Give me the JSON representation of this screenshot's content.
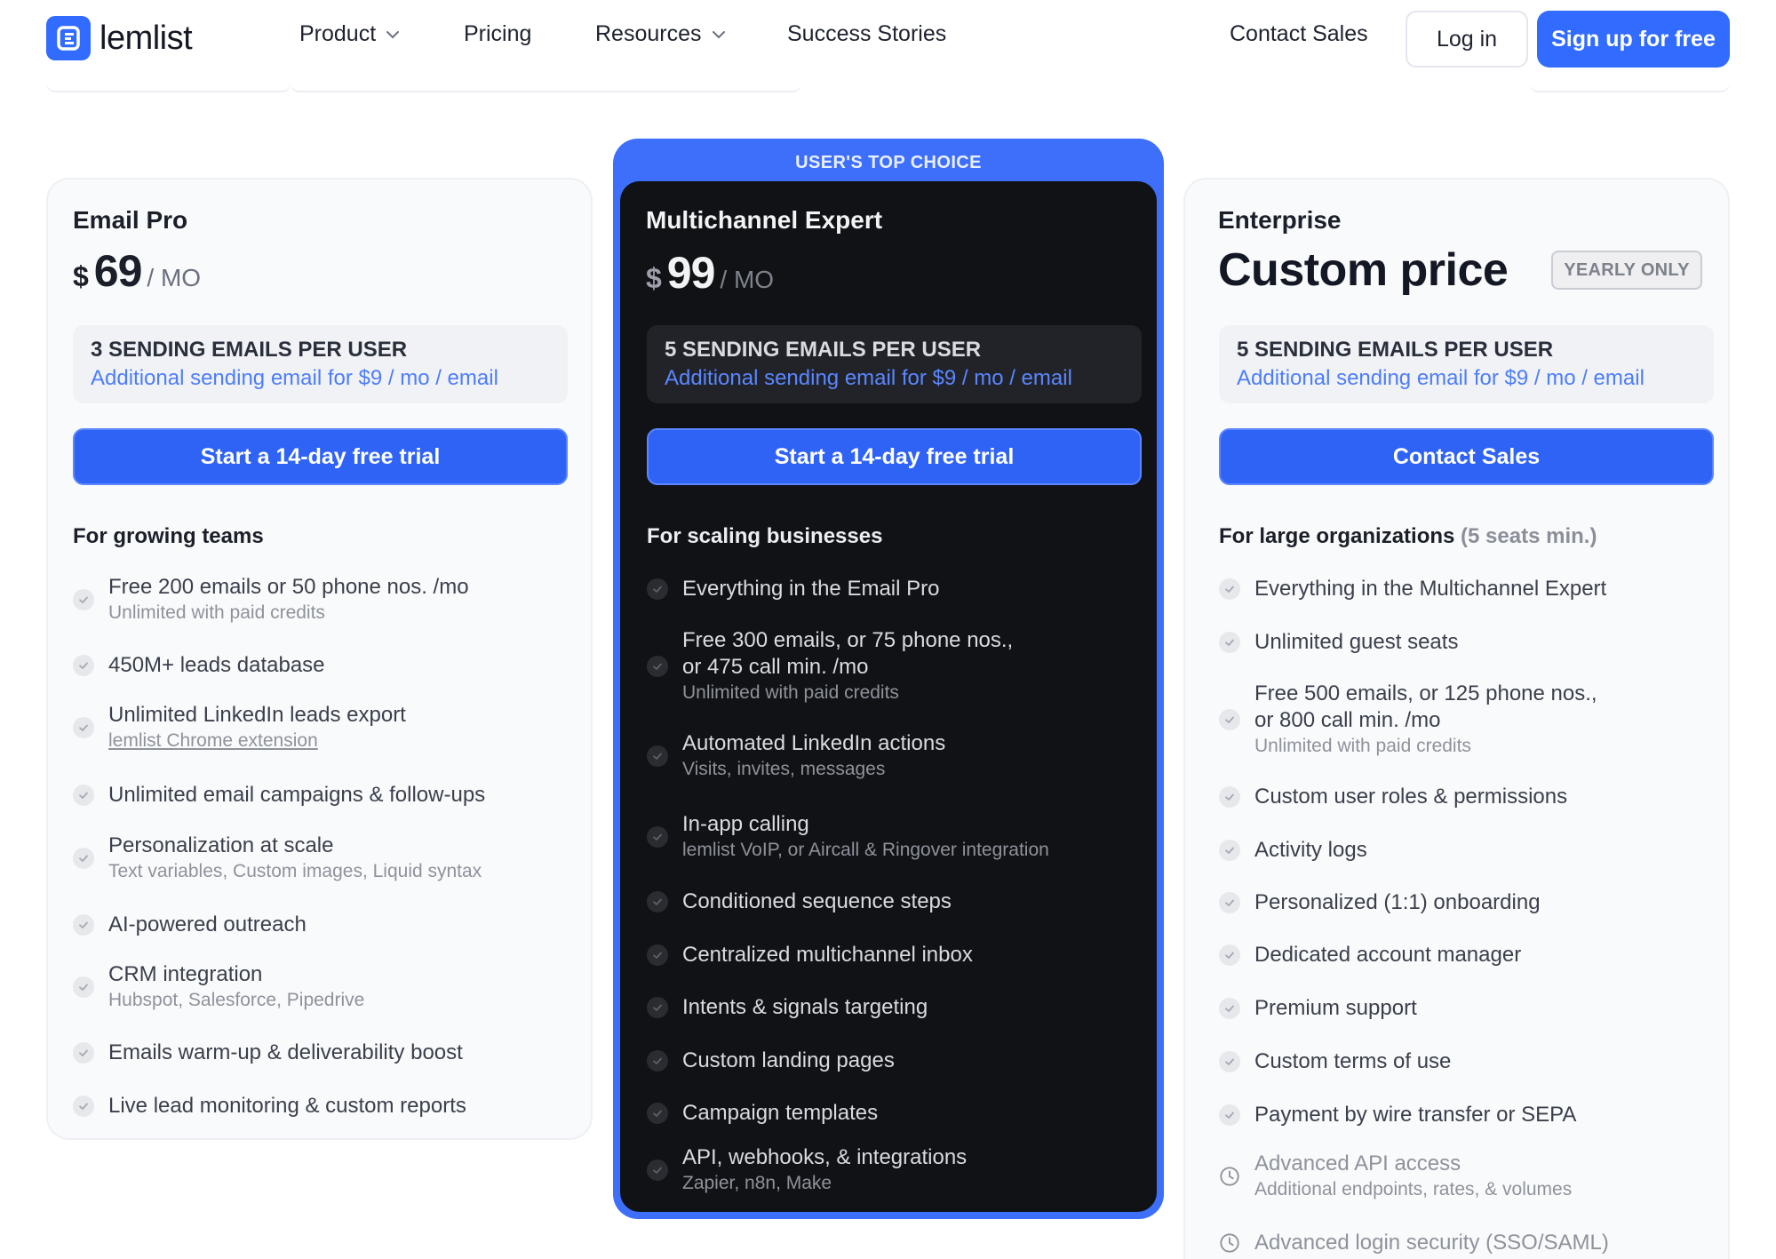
{
  "nav": {
    "logo_text": "lemlist",
    "items": [
      {
        "label": "Product",
        "dropdown": true
      },
      {
        "label": "Pricing",
        "dropdown": false
      },
      {
        "label": "Resources",
        "dropdown": true
      },
      {
        "label": "Success Stories",
        "dropdown": false
      }
    ],
    "contact_sales": "Contact Sales",
    "login": "Log in",
    "signup": "Sign up for free"
  },
  "colors": {
    "accent": "#316bff",
    "dark_card": "#111215",
    "highlight_border": "#3d6ffb",
    "link_blue": "#4c7dfb"
  },
  "plans": [
    {
      "name": "Email Pro",
      "currency": "$",
      "price": "69",
      "period": "/ MO",
      "sending_title": "3 sending emails per user",
      "sending_extra": "Additional sending email for $9  / mo / email",
      "cta": "Start a 14-day free trial",
      "for": "For growing teams",
      "features": [
        {
          "main": "Free 200 emails or 50 phone nos. /mo",
          "sub": "Unlimited with paid credits"
        },
        {
          "main": "450M+ leads database",
          "sub": ""
        },
        {
          "main": "Unlimited LinkedIn leads export",
          "sub": "lemlist Chrome extension"
        },
        {
          "main": "Unlimited email campaigns & follow-ups",
          "sub": ""
        },
        {
          "main": "Personalization at scale",
          "sub": "Text variables, Custom images, Liquid syntax"
        },
        {
          "main": "AI-powered outreach",
          "sub": ""
        },
        {
          "main": "CRM integration",
          "sub": "Hubspot, Salesforce, Pipedrive"
        },
        {
          "main": "Emails warm-up & deliverability boost",
          "sub": ""
        },
        {
          "main": "Live lead monitoring & custom reports",
          "sub": ""
        }
      ]
    },
    {
      "badge": "USER'S TOP CHOICE",
      "name": "Multichannel Expert",
      "currency": "$",
      "price": "99",
      "period": "/ MO",
      "sending_title": "5 sending emails per user",
      "sending_extra": "Additional sending email for $9  / mo / email",
      "cta": "Start a 14-day free trial",
      "for": "For scaling businesses",
      "features": [
        {
          "main": "Everything in the Email Pro",
          "sub": ""
        },
        {
          "main": "Free 300 emails, or 75 phone nos., or 475 call min. /mo",
          "main_line1": "Free 300 emails, or 75 phone nos.,",
          "main_line2": "or 475 call min. /mo",
          "sub": "Unlimited with paid credits"
        },
        {
          "main": "Automated LinkedIn actions",
          "sub": "Visits, invites, messages"
        },
        {
          "main": "In-app calling",
          "sub": "lemlist VoIP, or Aircall & Ringover integration"
        },
        {
          "main": "Conditioned sequence steps",
          "sub": ""
        },
        {
          "main": "Centralized multichannel inbox",
          "sub": ""
        },
        {
          "main": "Intents & signals targeting",
          "sub": ""
        },
        {
          "main": "Custom landing pages",
          "sub": ""
        },
        {
          "main": "Campaign templates",
          "sub": ""
        },
        {
          "main": "API, webhooks, & integrations",
          "sub": "Zapier, n8n, Make"
        }
      ]
    },
    {
      "name": "Enterprise",
      "price_text": "Custom price",
      "billing_badge": "YEARLY ONLY",
      "sending_title": "5 sending emails per user",
      "sending_extra": "Additional sending email for $9  / mo / email",
      "cta": "Contact Sales",
      "for": "For large organizations",
      "for_note": "(5 seats min.)",
      "features": [
        {
          "main": "Everything in the Multichannel Expert",
          "sub": "",
          "icon": "check-icon"
        },
        {
          "main": "Unlimited guest seats",
          "sub": "",
          "icon": "check-icon"
        },
        {
          "main_line1": "Free 500 emails, or 125 phone nos.,",
          "main_line2": "or 800 call min. /mo",
          "sub": "Unlimited with paid credits",
          "icon": "check-icon"
        },
        {
          "main": "Custom user roles & permissions",
          "sub": "",
          "icon": "check-icon"
        },
        {
          "main": "Activity logs",
          "sub": "",
          "icon": "check-icon"
        },
        {
          "main": "Personalized (1:1) onboarding",
          "sub": "",
          "icon": "check-icon"
        },
        {
          "main": "Dedicated account manager",
          "sub": "",
          "icon": "check-icon"
        },
        {
          "main": "Premium support",
          "sub": "",
          "icon": "check-icon"
        },
        {
          "main": "Custom terms of use",
          "sub": "",
          "icon": "check-icon"
        },
        {
          "main": "Payment by wire transfer or SEPA",
          "sub": "",
          "icon": "check-icon"
        },
        {
          "main": "Advanced API access",
          "sub": "Additional endpoints, rates, & volumes",
          "icon": "clock-icon"
        },
        {
          "main": "Advanced login security (SSO/SAML)",
          "sub": "",
          "icon": "clock-icon"
        }
      ]
    }
  ]
}
